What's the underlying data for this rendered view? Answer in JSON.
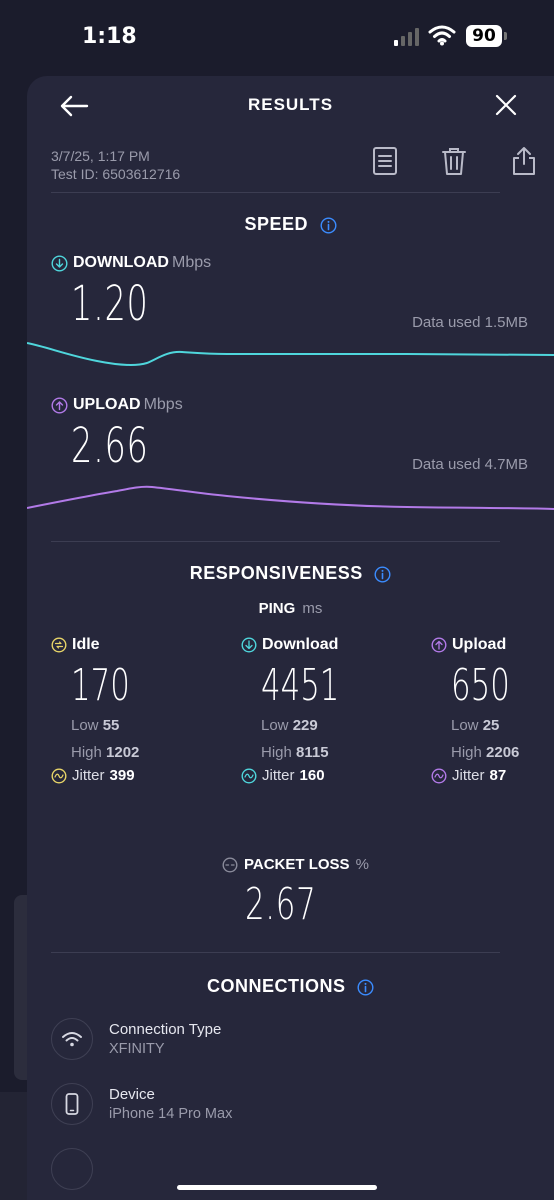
{
  "status_bar": {
    "time": "1:18",
    "battery": "90"
  },
  "header": {
    "title": "RESULTS"
  },
  "meta": {
    "date": "3/7/25, 1:17 PM",
    "test_id": "Test ID: 6503612716"
  },
  "speed": {
    "title": "SPEED",
    "download": {
      "label": "DOWNLOAD",
      "unit": "Mbps",
      "value": "1.20",
      "data_used": "Data used 1.5MB"
    },
    "upload": {
      "label": "UPLOAD",
      "unit": "Mbps",
      "value": "2.66",
      "data_used": "Data used 4.7MB"
    }
  },
  "responsiveness": {
    "title": "RESPONSIVENESS",
    "ping_label": "PING",
    "ping_unit": "ms",
    "columns": [
      {
        "name": "Idle",
        "value": "170",
        "low_label": "Low",
        "low": "55",
        "high_label": "High",
        "high": "1202",
        "jitter_label": "Jitter",
        "jitter": "399",
        "color": "#e7d468"
      },
      {
        "name": "Download",
        "value": "4451",
        "low_label": "Low",
        "low": "229",
        "high_label": "High",
        "high": "8115",
        "jitter_label": "Jitter",
        "jitter": "160",
        "color": "#4fd6dc"
      },
      {
        "name": "Upload",
        "value": "650",
        "low_label": "Low",
        "low": "25",
        "high_label": "High",
        "high": "2206",
        "jitter_label": "Jitter",
        "jitter": "87",
        "color": "#b27ae8"
      }
    ]
  },
  "packet_loss": {
    "label": "PACKET LOSS",
    "unit": "%",
    "value": "2.67"
  },
  "connections": {
    "title": "CONNECTIONS",
    "items": [
      {
        "label": "Connection Type",
        "value": "XFINITY",
        "icon": "wifi-icon"
      },
      {
        "label": "Device",
        "value": "iPhone 14 Pro Max",
        "icon": "phone-icon"
      }
    ]
  },
  "colors": {
    "download": "#4fd6dc",
    "upload": "#b27ae8",
    "info": "#3b8cff",
    "idle": "#e7d468"
  }
}
